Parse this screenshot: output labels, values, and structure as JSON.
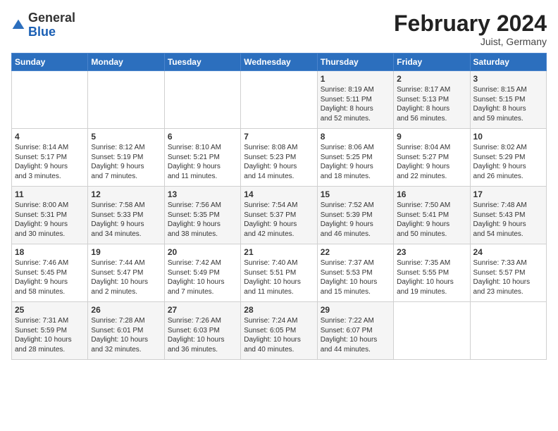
{
  "header": {
    "logo_general": "General",
    "logo_blue": "Blue",
    "month_title": "February 2024",
    "location": "Juist, Germany"
  },
  "days_of_week": [
    "Sunday",
    "Monday",
    "Tuesday",
    "Wednesday",
    "Thursday",
    "Friday",
    "Saturday"
  ],
  "weeks": [
    [
      {
        "day": "",
        "info": ""
      },
      {
        "day": "",
        "info": ""
      },
      {
        "day": "",
        "info": ""
      },
      {
        "day": "",
        "info": ""
      },
      {
        "day": "1",
        "info": "Sunrise: 8:19 AM\nSunset: 5:11 PM\nDaylight: 8 hours\nand 52 minutes."
      },
      {
        "day": "2",
        "info": "Sunrise: 8:17 AM\nSunset: 5:13 PM\nDaylight: 8 hours\nand 56 minutes."
      },
      {
        "day": "3",
        "info": "Sunrise: 8:15 AM\nSunset: 5:15 PM\nDaylight: 8 hours\nand 59 minutes."
      }
    ],
    [
      {
        "day": "4",
        "info": "Sunrise: 8:14 AM\nSunset: 5:17 PM\nDaylight: 9 hours\nand 3 minutes."
      },
      {
        "day": "5",
        "info": "Sunrise: 8:12 AM\nSunset: 5:19 PM\nDaylight: 9 hours\nand 7 minutes."
      },
      {
        "day": "6",
        "info": "Sunrise: 8:10 AM\nSunset: 5:21 PM\nDaylight: 9 hours\nand 11 minutes."
      },
      {
        "day": "7",
        "info": "Sunrise: 8:08 AM\nSunset: 5:23 PM\nDaylight: 9 hours\nand 14 minutes."
      },
      {
        "day": "8",
        "info": "Sunrise: 8:06 AM\nSunset: 5:25 PM\nDaylight: 9 hours\nand 18 minutes."
      },
      {
        "day": "9",
        "info": "Sunrise: 8:04 AM\nSunset: 5:27 PM\nDaylight: 9 hours\nand 22 minutes."
      },
      {
        "day": "10",
        "info": "Sunrise: 8:02 AM\nSunset: 5:29 PM\nDaylight: 9 hours\nand 26 minutes."
      }
    ],
    [
      {
        "day": "11",
        "info": "Sunrise: 8:00 AM\nSunset: 5:31 PM\nDaylight: 9 hours\nand 30 minutes."
      },
      {
        "day": "12",
        "info": "Sunrise: 7:58 AM\nSunset: 5:33 PM\nDaylight: 9 hours\nand 34 minutes."
      },
      {
        "day": "13",
        "info": "Sunrise: 7:56 AM\nSunset: 5:35 PM\nDaylight: 9 hours\nand 38 minutes."
      },
      {
        "day": "14",
        "info": "Sunrise: 7:54 AM\nSunset: 5:37 PM\nDaylight: 9 hours\nand 42 minutes."
      },
      {
        "day": "15",
        "info": "Sunrise: 7:52 AM\nSunset: 5:39 PM\nDaylight: 9 hours\nand 46 minutes."
      },
      {
        "day": "16",
        "info": "Sunrise: 7:50 AM\nSunset: 5:41 PM\nDaylight: 9 hours\nand 50 minutes."
      },
      {
        "day": "17",
        "info": "Sunrise: 7:48 AM\nSunset: 5:43 PM\nDaylight: 9 hours\nand 54 minutes."
      }
    ],
    [
      {
        "day": "18",
        "info": "Sunrise: 7:46 AM\nSunset: 5:45 PM\nDaylight: 9 hours\nand 58 minutes."
      },
      {
        "day": "19",
        "info": "Sunrise: 7:44 AM\nSunset: 5:47 PM\nDaylight: 10 hours\nand 2 minutes."
      },
      {
        "day": "20",
        "info": "Sunrise: 7:42 AM\nSunset: 5:49 PM\nDaylight: 10 hours\nand 7 minutes."
      },
      {
        "day": "21",
        "info": "Sunrise: 7:40 AM\nSunset: 5:51 PM\nDaylight: 10 hours\nand 11 minutes."
      },
      {
        "day": "22",
        "info": "Sunrise: 7:37 AM\nSunset: 5:53 PM\nDaylight: 10 hours\nand 15 minutes."
      },
      {
        "day": "23",
        "info": "Sunrise: 7:35 AM\nSunset: 5:55 PM\nDaylight: 10 hours\nand 19 minutes."
      },
      {
        "day": "24",
        "info": "Sunrise: 7:33 AM\nSunset: 5:57 PM\nDaylight: 10 hours\nand 23 minutes."
      }
    ],
    [
      {
        "day": "25",
        "info": "Sunrise: 7:31 AM\nSunset: 5:59 PM\nDaylight: 10 hours\nand 28 minutes."
      },
      {
        "day": "26",
        "info": "Sunrise: 7:28 AM\nSunset: 6:01 PM\nDaylight: 10 hours\nand 32 minutes."
      },
      {
        "day": "27",
        "info": "Sunrise: 7:26 AM\nSunset: 6:03 PM\nDaylight: 10 hours\nand 36 minutes."
      },
      {
        "day": "28",
        "info": "Sunrise: 7:24 AM\nSunset: 6:05 PM\nDaylight: 10 hours\nand 40 minutes."
      },
      {
        "day": "29",
        "info": "Sunrise: 7:22 AM\nSunset: 6:07 PM\nDaylight: 10 hours\nand 44 minutes."
      },
      {
        "day": "",
        "info": ""
      },
      {
        "day": "",
        "info": ""
      }
    ]
  ]
}
